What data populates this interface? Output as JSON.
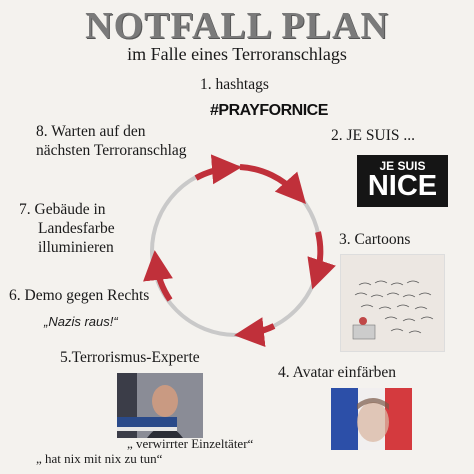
{
  "header": {
    "title": "NOTFALL PLAN",
    "subtitle": "im Falle eines Terroranschlags"
  },
  "steps": [
    {
      "label": "1. hashtags",
      "extra": "#PRAYFORNICE"
    },
    {
      "label": "2. JE SUIS ..."
    },
    {
      "label": "3. Cartoons"
    },
    {
      "label": "4. Avatar einfärben"
    },
    {
      "label": "5.Terrorismus-Experte",
      "quote_line1": "„ verwirrter Einzeltäter“",
      "quote_line2": "„ hat nix mit nix zu tun“"
    },
    {
      "label": "6. Demo gegen Rechts",
      "quote": "„Nazis raus!“"
    },
    {
      "label_line1": "7. Gebäude in",
      "label_line2": "Landesfarbe",
      "label_line3": "illuminieren"
    },
    {
      "label_line1": "8. Warten auf den",
      "label_line2": "nächsten Terroranschlag"
    }
  ],
  "jesuis_image": {
    "line1": "JE SUIS",
    "line2": "NICE"
  },
  "colors": {
    "arrow": "#c0303a",
    "circle": "#c8c8c8",
    "title": "#7a7a7a",
    "background": "#f4f2ee"
  }
}
